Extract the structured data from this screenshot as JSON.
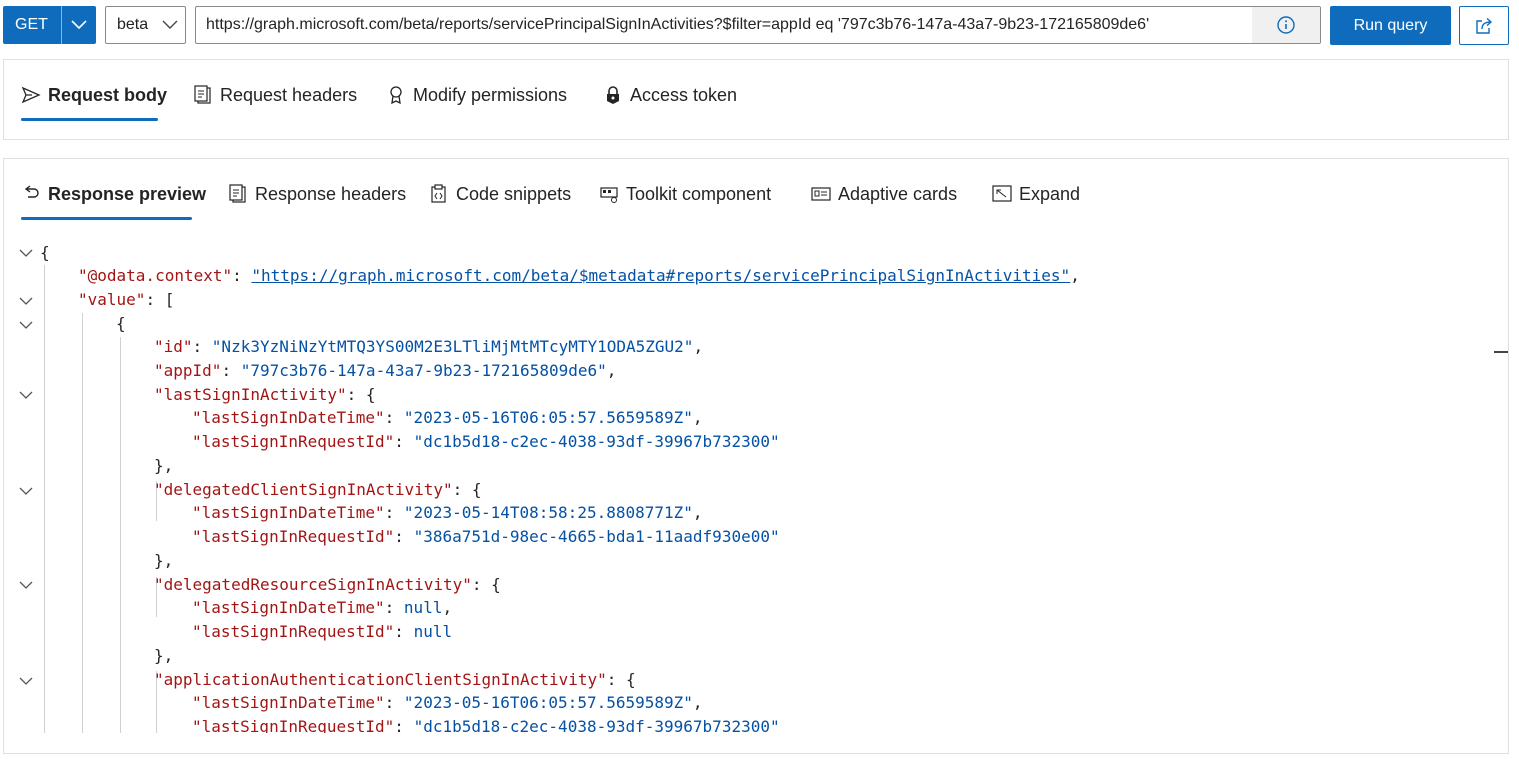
{
  "query": {
    "method": "GET",
    "version": "beta",
    "url": "https://graph.microsoft.com/beta/reports/servicePrincipalSignInActivities?$filter=appId eq '797c3b76-147a-43a7-9b23-172165809de6'",
    "run_label": "Run query"
  },
  "request_tabs": [
    {
      "label": "Request body",
      "icon": "send-icon"
    },
    {
      "label": "Request headers",
      "icon": "headers-icon"
    },
    {
      "label": "Modify permissions",
      "icon": "permissions-icon"
    },
    {
      "label": "Access token",
      "icon": "lock-icon"
    }
  ],
  "response_tabs": [
    {
      "label": "Response preview",
      "icon": "undo-arrow-icon"
    },
    {
      "label": "Response headers",
      "icon": "headers-icon"
    },
    {
      "label": "Code snippets",
      "icon": "code-clipboard-icon"
    },
    {
      "label": "Toolkit component",
      "icon": "toolkit-icon"
    },
    {
      "label": "Adaptive cards",
      "icon": "card-icon"
    },
    {
      "label": "Expand",
      "icon": "expand-icon"
    }
  ],
  "response": {
    "odata_context_key": "\"@odata.context\"",
    "odata_context_value": "\"https://graph.microsoft.com/beta/$metadata#reports/servicePrincipalSignInActivities\"",
    "value_key": "\"value\"",
    "id_key": "\"id\"",
    "id_value": "\"Nzk3YzNiNzYtMTQ3YS00M2E3LTliMjMtMTcyMTY1ODA5ZGU2\"",
    "appId_key": "\"appId\"",
    "appId_value": "\"797c3b76-147a-43a7-9b23-172165809de6\"",
    "lastSignInActivity_key": "\"lastSignInActivity\"",
    "lastSignInDateTime_key": "\"lastSignInDateTime\"",
    "lastSignInRequestId_key": "\"lastSignInRequestId\"",
    "lsa_datetime": "\"2023-05-16T06:05:57.5659589Z\"",
    "lsa_requestid": "\"dc1b5d18-c2ec-4038-93df-39967b732300\"",
    "delegatedClient_key": "\"delegatedClientSignInActivity\"",
    "dca_datetime": "\"2023-05-14T08:58:25.8808771Z\"",
    "dca_requestid": "\"386a751d-98ec-4665-bda1-11aadf930e00\"",
    "delegatedResource_key": "\"delegatedResourceSignInActivity\"",
    "null_value": "null",
    "appAuthClient_key": "\"applicationAuthenticationClientSignInActivity\"",
    "aac_datetime": "\"2023-05-16T06:05:57.5659589Z\"",
    "aac_requestid": "\"dc1b5d18-c2ec-4038-93df-39967b732300\""
  }
}
